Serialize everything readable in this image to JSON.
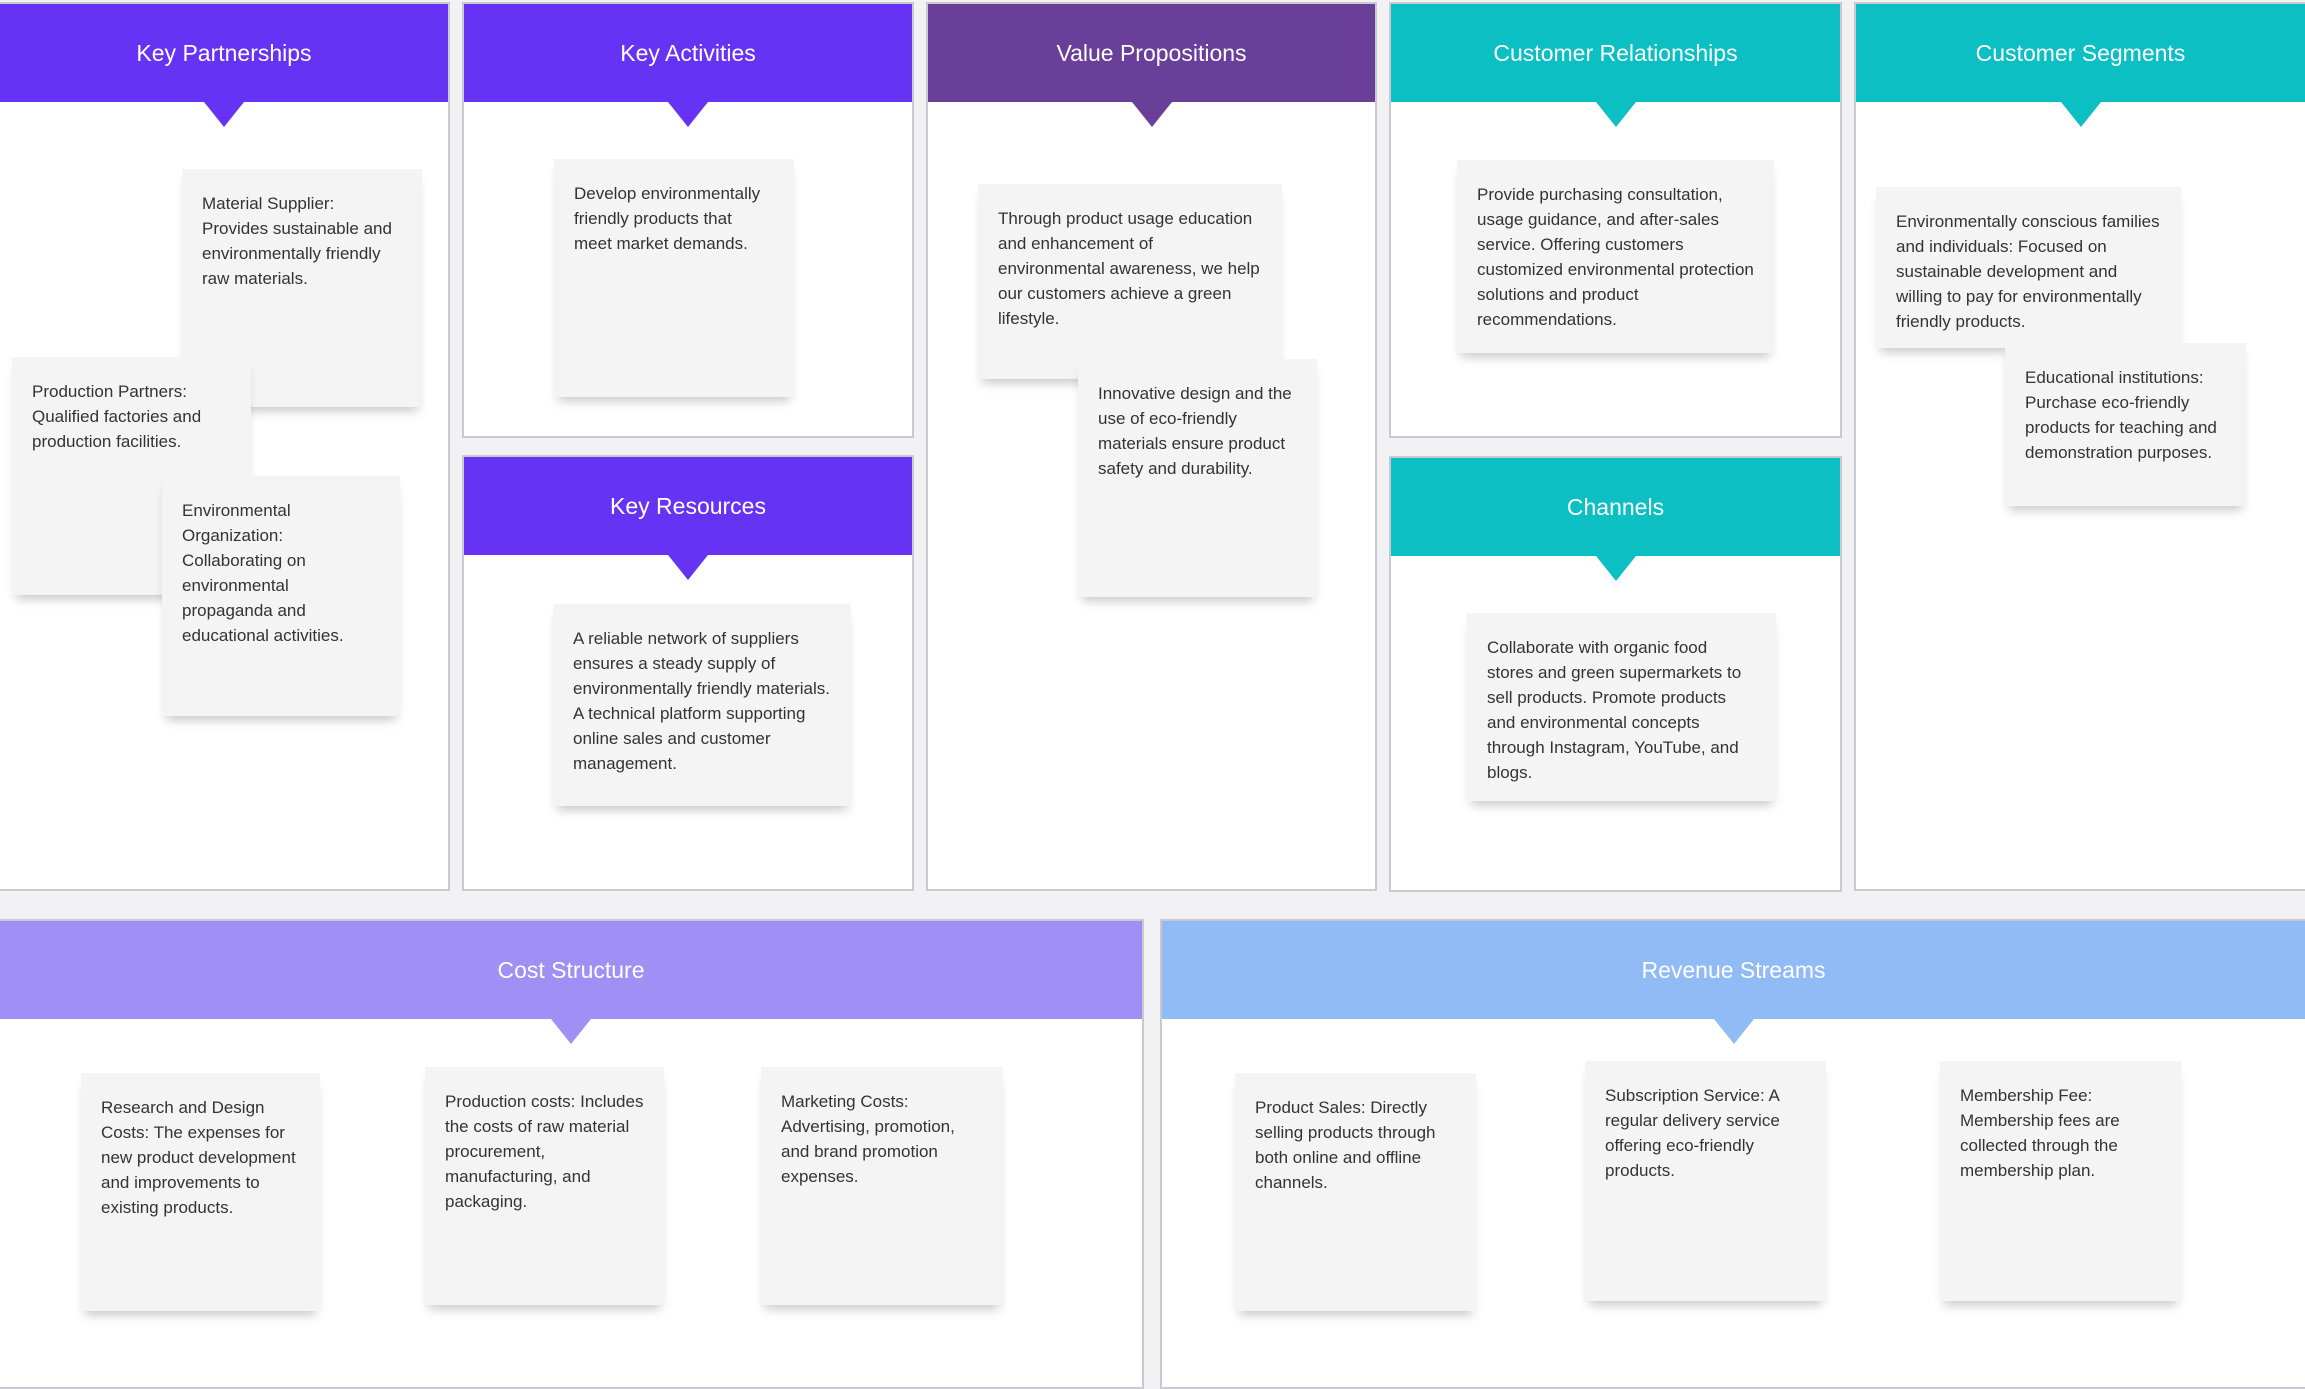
{
  "colors": {
    "activity": "#6633f5",
    "value": "#6a3f99",
    "customer": "#0bbfc3",
    "cost": "#a090f5",
    "revenue": "#90bbf5"
  },
  "key_partnerships": {
    "title": "Key Partnerships",
    "notes": [
      "Material Supplier: Provides sustainable and environmentally friendly raw materials.",
      "Production Partners: Qualified factories and production facilities.",
      "Environmental Organization: Collaborating on environmental propaganda and educational activities."
    ]
  },
  "key_activities": {
    "title": "Key Activities",
    "notes": [
      "Develop environmentally friendly products that meet market demands."
    ]
  },
  "key_resources": {
    "title": "Key Resources",
    "notes": [
      "A reliable network of suppliers ensures a steady supply of environmentally friendly materials. A technical platform supporting online sales and customer management."
    ]
  },
  "value_propositions": {
    "title": "Value Propositions",
    "notes": [
      "Through product usage education and enhancement of environmental awareness, we help our customers achieve a green lifestyle.",
      "Innovative design and the use of eco-friendly materials ensure product safety and durability."
    ]
  },
  "customer_relationships": {
    "title": "Customer Relationships",
    "notes": [
      "Provide purchasing consultation, usage guidance, and after-sales service. Offering customers customized environmental protection solutions and product recommendations."
    ]
  },
  "channels": {
    "title": "Channels",
    "notes": [
      "Collaborate with organic food stores and green supermarkets to sell products. Promote products and environmental concepts through Instagram, YouTube, and blogs."
    ]
  },
  "customer_segments": {
    "title": "Customer Segments",
    "notes": [
      "Environmentally conscious families and individuals: Focused on sustainable development and willing to pay for environmentally friendly products.",
      "Educational institutions: Purchase eco-friendly products for teaching and demonstration purposes."
    ]
  },
  "cost_structure": {
    "title": "Cost Structure",
    "notes": [
      "Research and Design Costs: The expenses for new product development and improvements to existing products.",
      "Production costs: Includes the costs of raw material procurement, manufacturing, and packaging.",
      "Marketing Costs: Advertising, promotion, and brand promotion expenses."
    ]
  },
  "revenue_streams": {
    "title": "Revenue Streams",
    "notes": [
      "Product Sales: Directly selling products through both online and offline channels.",
      "Subscription Service: A regular delivery service offering eco-friendly products.",
      "Membership Fee: Membership fees are collected through the membership plan."
    ]
  }
}
